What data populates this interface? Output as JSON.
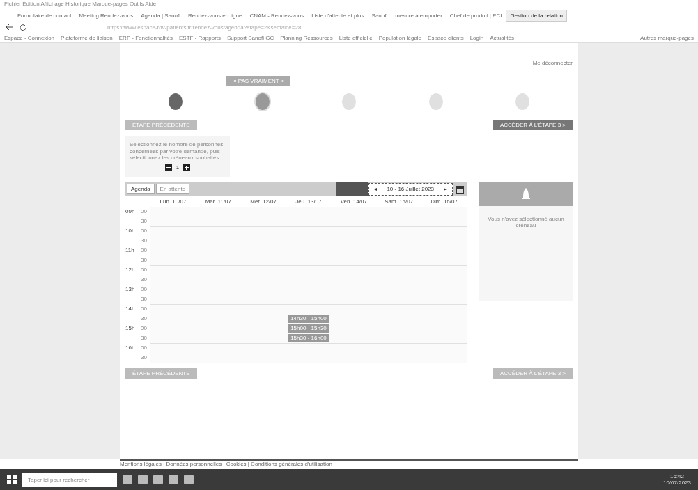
{
  "browser": {
    "title_bar": "Fichier Édition Affichage Historique Marque-pages Outils Aide",
    "tabs": [
      {
        "label": "Formulaire de contact",
        "selected": false
      },
      {
        "label": "Meeting Rendez-vous",
        "selected": false
      },
      {
        "label": "Agenda | Sanofi",
        "selected": false
      },
      {
        "label": "Rendez-vous en ligne",
        "selected": false
      },
      {
        "label": "CNAM - Rendez-vous",
        "selected": false
      },
      {
        "label": "Liste d'attente et plus",
        "selected": false
      },
      {
        "label": "Sanofi",
        "selected": false
      },
      {
        "label": "mesure à emporter",
        "selected": false
      },
      {
        "label": "Chef de produit | PCI",
        "selected": false
      },
      {
        "label": "Gestion de la relation",
        "selected": true
      }
    ],
    "url": "https://www.espace-rdv-patients.fr/rendez-vous/agenda?etape=2&semaine=28",
    "bookmarks": [
      "Espace - Connexion",
      "Plateforme de liaison",
      "ERP - Fonctionnalités",
      "ESTF - Rapports",
      "Support Sanofi GC",
      "Planning Ressources",
      "Liste officielle",
      "Population légale",
      "Espace clients",
      "Login",
      "Actualités"
    ],
    "other_bookmarks": "Autres marque-pages"
  },
  "page": {
    "logout": "Me déconnecter",
    "top_button": "« PAS VRAIMENT »",
    "steps": [
      {
        "done": true,
        "selected": false
      },
      {
        "done": false,
        "selected": true
      },
      {
        "done": false,
        "selected": false
      },
      {
        "done": false,
        "selected": false
      },
      {
        "done": false,
        "selected": false
      }
    ],
    "prev_button": "ÉTAPE PRÉCÉDENTE",
    "next_button": "ACCÉDER À L'ÉTAPE 3 >",
    "info": "Sélectionnez le nombre de personnes concernées par votre demande, puis sélectionnez les créneaux souhaités",
    "count": "1",
    "views": [
      {
        "label": "Agenda",
        "selected": true
      },
      {
        "label": "En attente",
        "selected": false
      }
    ],
    "week": "10 - 16 Juillet 2023",
    "prev": "◂",
    "next": "▸",
    "days": [
      "Lun. 10/07",
      "Mar. 11/07",
      "Mer. 12/07",
      "Jeu. 13/07",
      "Ven. 14/07",
      "Sam. 15/07",
      "Dim. 16/07"
    ],
    "rows": [
      {
        "hour": "09h",
        "minute": "00"
      },
      {
        "minute": "30"
      },
      {
        "hour": "10h",
        "minute": "00"
      },
      {
        "minute": "30"
      },
      {
        "hour": "11h",
        "minute": "00"
      },
      {
        "minute": "30"
      },
      {
        "hour": "12h",
        "minute": "00"
      },
      {
        "minute": "30"
      },
      {
        "hour": "13h",
        "minute": "00"
      },
      {
        "minute": "30"
      },
      {
        "hour": "14h",
        "minute": "00"
      },
      {
        "minute": "30"
      },
      {
        "hour": "15h",
        "minute": "00"
      },
      {
        "minute": "30"
      },
      {
        "hour": "16h",
        "minute": "00"
      },
      {
        "minute": "30"
      }
    ],
    "events": [
      {
        "label": "14h30 - 15h00"
      },
      {
        "label": "15h00 - 15h30"
      },
      {
        "label": "15h30 - 16h00"
      }
    ],
    "panel_text": "Vous n'avez sélectionné aucun créneau",
    "prev_button_2": "ÉTAPE PRÉCÉDENTE",
    "next_button_2": "ACCÉDER À L'ÉTAPE 3 >",
    "footer": "Mentions légales | Données personnelles | Cookies | Conditions générales d'utilisation"
  },
  "taskbar": {
    "search": "Taper ici pour rechercher",
    "time": "16:42",
    "date": "10/07/2023"
  }
}
